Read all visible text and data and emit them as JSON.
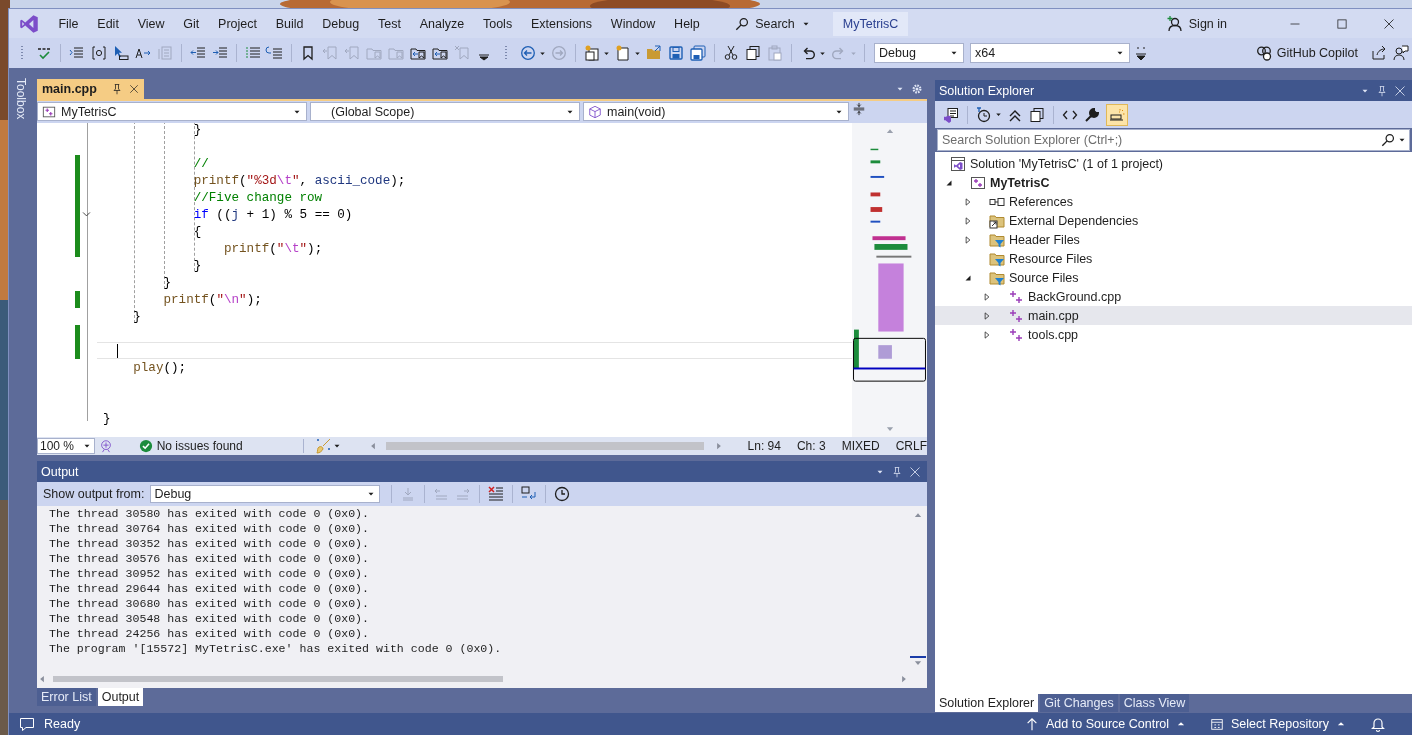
{
  "menu": [
    "File",
    "Edit",
    "View",
    "Git",
    "Project",
    "Build",
    "Debug",
    "Test",
    "Analyze",
    "Tools",
    "Extensions",
    "Window",
    "Help"
  ],
  "search": {
    "label": "Search"
  },
  "solution_badge": "MyTetrisC",
  "account": {
    "label": "Sign in"
  },
  "toolbar": {
    "configuration": "Debug",
    "platform": "x64",
    "copilot": "GitHub Copilot"
  },
  "toolbox": "Toolbox",
  "editor": {
    "tabs": [
      {
        "label": "main.cpp",
        "selected": true
      }
    ],
    "nav": {
      "project": "MyTetrisC",
      "scope": "(Global Scope)",
      "member": "main(void)"
    },
    "lines": [
      {
        "changed": false,
        "current": false,
        "foldable": false,
        "tokens": [
          {
            "kind": "plain",
            "t": "            }"
          }
        ]
      },
      {
        "changed": false,
        "current": false,
        "foldable": false
      },
      {
        "changed": true,
        "current": false,
        "foldable": false,
        "tokens": [
          {
            "kind": "comment",
            "t": "            //"
          }
        ]
      },
      {
        "changed": true,
        "current": false,
        "foldable": false,
        "tokens": [
          {
            "kind": "function",
            "t": "            printf"
          },
          {
            "kind": "plain",
            "t": "("
          },
          {
            "kind": "string",
            "t": "\"%3d"
          },
          {
            "kind": "escape",
            "t": "\\t"
          },
          {
            "kind": "string",
            "t": "\""
          },
          {
            "kind": "plain",
            "t": ", "
          },
          {
            "kind": "variable",
            "t": "ascii_code"
          },
          {
            "kind": "plain",
            "t": ");"
          }
        ]
      },
      {
        "changed": true,
        "current": false,
        "foldable": false,
        "tokens": [
          {
            "kind": "comment",
            "t": "            //Five change row"
          }
        ]
      },
      {
        "changed": true,
        "current": false,
        "foldable": true,
        "tokens": [
          {
            "kind": "keyword",
            "t": "            if"
          },
          {
            "kind": "plain",
            "t": " (("
          },
          {
            "kind": "variable",
            "t": "j"
          },
          {
            "kind": "plain",
            "t": " + 1) % 5 == 0)"
          }
        ]
      },
      {
        "changed": true,
        "current": false,
        "foldable": false,
        "tokens": [
          {
            "kind": "plain",
            "t": "            {"
          }
        ]
      },
      {
        "changed": true,
        "current": false,
        "foldable": false,
        "tokens": [
          {
            "kind": "function",
            "t": "                printf"
          },
          {
            "kind": "plain",
            "t": "("
          },
          {
            "kind": "string",
            "t": "\""
          },
          {
            "kind": "escape",
            "t": "\\t"
          },
          {
            "kind": "string",
            "t": "\""
          },
          {
            "kind": "plain",
            "t": ");"
          }
        ]
      },
      {
        "changed": false,
        "current": false,
        "foldable": false,
        "tokens": [
          {
            "kind": "plain",
            "t": "            }"
          }
        ]
      },
      {
        "changed": false,
        "current": false,
        "foldable": false,
        "tokens": [
          {
            "kind": "plain",
            "t": "        }"
          }
        ]
      },
      {
        "changed": true,
        "current": false,
        "foldable": false,
        "tokens": [
          {
            "kind": "function",
            "t": "        printf"
          },
          {
            "kind": "plain",
            "t": "("
          },
          {
            "kind": "string",
            "t": "\""
          },
          {
            "kind": "escape",
            "t": "\\n"
          },
          {
            "kind": "string",
            "t": "\""
          },
          {
            "kind": "plain",
            "t": ");"
          }
        ]
      },
      {
        "changed": false,
        "current": false,
        "foldable": false,
        "tokens": [
          {
            "kind": "plain",
            "t": "    }"
          }
        ]
      },
      {
        "changed": true,
        "current": false,
        "foldable": false
      },
      {
        "changed": true,
        "current": true,
        "foldable": false
      },
      {
        "changed": false,
        "current": false,
        "foldable": false,
        "tokens": [
          {
            "kind": "function",
            "t": "    play"
          },
          {
            "kind": "plain",
            "t": "();"
          }
        ]
      },
      {
        "changed": false,
        "current": false,
        "foldable": false
      },
      {
        "changed": false,
        "current": false,
        "foldable": false
      },
      {
        "changed": false,
        "current": false,
        "foldable": false,
        "tokens": [
          {
            "kind": "plain",
            "t": "}"
          }
        ]
      }
    ],
    "status": {
      "zoom": "100 %",
      "issues": "No issues found",
      "line": "Ln: 94",
      "column": "Ch: 3",
      "encoding": "MIXED",
      "line_endings": "CRLF"
    }
  },
  "output": {
    "title": "Output",
    "source_label": "Show output from:",
    "source": "Debug",
    "lines": [
      "The thread 30580 has exited with code 0 (0x0).",
      "The thread 30764 has exited with code 0 (0x0).",
      "The thread 30352 has exited with code 0 (0x0).",
      "The thread 30576 has exited with code 0 (0x0).",
      "The thread 30952 has exited with code 0 (0x0).",
      "The thread 29644 has exited with code 0 (0x0).",
      "The thread 30680 has exited with code 0 (0x0).",
      "The thread 30548 has exited with code 0 (0x0).",
      "The thread 24256 has exited with code 0 (0x0).",
      "The program '[15572] MyTetrisC.exe' has exited with code 0 (0x0)."
    ],
    "tabs": [
      {
        "label": "Error List",
        "selected": false
      },
      {
        "label": "Output",
        "selected": true
      }
    ]
  },
  "solution_explorer": {
    "title": "Solution Explorer",
    "search": {
      "placeholder": "Search Solution Explorer (Ctrl+;)"
    },
    "tree": [
      {
        "label": "Solution 'MyTetrisC' (1 of 1 project)",
        "kind": "solution",
        "expandable": false,
        "selected": false,
        "children": [
          {
            "label": "MyTetrisC",
            "kind": "project",
            "expandable": true,
            "expanded": true,
            "selected": false,
            "children": [
              {
                "label": "References",
                "kind": "references",
                "expandable": true,
                "expanded": false,
                "selected": false
              },
              {
                "label": "External Dependencies",
                "kind": "external",
                "expandable": true,
                "expanded": false,
                "selected": false
              },
              {
                "label": "Header Files",
                "kind": "filter",
                "expandable": true,
                "expanded": false,
                "selected": false
              },
              {
                "label": "Resource Files",
                "kind": "filter",
                "expandable": false,
                "selected": false
              },
              {
                "label": "Source Files",
                "kind": "filter",
                "expandable": true,
                "expanded": true,
                "selected": false,
                "children": [
                  {
                    "label": "BackGround.cpp",
                    "kind": "cpp",
                    "expandable": true,
                    "expanded": false,
                    "selected": false
                  },
                  {
                    "label": "main.cpp",
                    "kind": "cpp",
                    "expandable": true,
                    "expanded": false,
                    "selected": true
                  },
                  {
                    "label": "tools.cpp",
                    "kind": "cpp",
                    "expandable": true,
                    "expanded": false,
                    "selected": false
                  }
                ]
              }
            ]
          }
        ]
      }
    ],
    "tabs": [
      {
        "label": "Solution Explorer",
        "selected": true
      },
      {
        "label": "Git Changes",
        "selected": false
      },
      {
        "label": "Class View",
        "selected": false
      }
    ]
  },
  "status_bar": {
    "state": "Ready",
    "source_control": "Add to Source Control",
    "repository": "Select Repository"
  }
}
